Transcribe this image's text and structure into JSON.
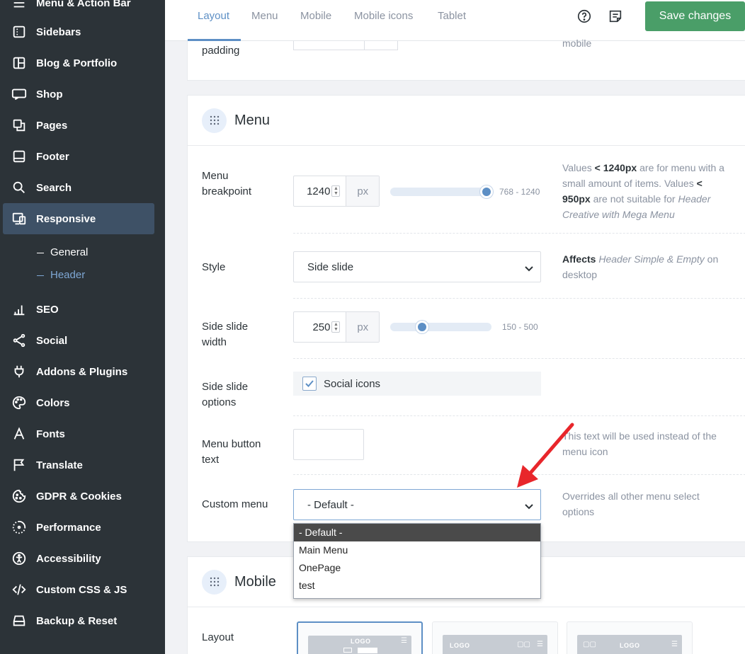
{
  "sidebar": {
    "items": [
      {
        "label": "Menu & Action Bar",
        "icon": "menu-icon"
      },
      {
        "label": "Sidebars",
        "icon": "sidebar-icon"
      },
      {
        "label": "Blog & Portfolio",
        "icon": "grid-icon"
      },
      {
        "label": "Shop",
        "icon": "woo-icon"
      },
      {
        "label": "Pages",
        "icon": "pages-icon"
      },
      {
        "label": "Footer",
        "icon": "footer-icon"
      },
      {
        "label": "Search",
        "icon": "search-icon"
      },
      {
        "label": "Responsive",
        "icon": "devices-icon",
        "active": true
      },
      {
        "label": "SEO",
        "icon": "bar-chart-icon"
      },
      {
        "label": "Social",
        "icon": "share-icon"
      },
      {
        "label": "Addons & Plugins",
        "icon": "plug-icon"
      },
      {
        "label": "Colors",
        "icon": "palette-icon"
      },
      {
        "label": "Fonts",
        "icon": "font-icon"
      },
      {
        "label": "Translate",
        "icon": "flag-icon"
      },
      {
        "label": "GDPR & Cookies",
        "icon": "cookie-icon"
      },
      {
        "label": "Performance",
        "icon": "gauge-icon"
      },
      {
        "label": "Accessibility",
        "icon": "accessibility-icon"
      },
      {
        "label": "Custom CSS & JS",
        "icon": "code-icon"
      },
      {
        "label": "Backup & Reset",
        "icon": "backup-icon"
      }
    ],
    "subitems": [
      {
        "label": "General",
        "active": false
      },
      {
        "label": "Header",
        "active": true
      }
    ]
  },
  "tabs": [
    "Layout",
    "Menu",
    "Mobile",
    "Mobile icons",
    "Tablet"
  ],
  "toolbar": {
    "save_label": "Save changes",
    "help_icon": "help-icon",
    "notes_icon": "notes-icon"
  },
  "top_partial": {
    "label": "padding",
    "help": "mobile"
  },
  "menu_section": {
    "title": "Menu",
    "breakpoint": {
      "label": "Menu breakpoint",
      "value": "1240",
      "unit": "px",
      "range": "768 - 1240",
      "min": 768,
      "max": 1240,
      "help_parts": [
        "Values ",
        "< 1240px",
        " are for menu with a small amount of items. Values ",
        "< 950px",
        " are not suitable for ",
        "Header Creative with Mega Menu"
      ]
    },
    "style": {
      "label": "Style",
      "value": "Side slide",
      "help_parts": [
        "Affects",
        " Header Simple & Empty",
        " on desktop"
      ]
    },
    "side_width": {
      "label": "Side slide width",
      "value": "250",
      "unit": "px",
      "range": "150 - 500",
      "min": 150,
      "max": 500
    },
    "side_options": {
      "label": "Side slide options",
      "checkbox_label": "Social icons",
      "checked": true
    },
    "button_text": {
      "label": "Menu button text",
      "value": "",
      "help": "This text will be used instead of the menu icon"
    },
    "custom_menu": {
      "label": "Custom menu",
      "value": "- Default -",
      "help": "Overrides all other menu select options",
      "options": [
        "- Default -",
        "Main Menu",
        "OnePage",
        "test"
      ]
    }
  },
  "mobile_section": {
    "title": "Mobile",
    "layout_label": "Layout",
    "tile_logo": "LOGO"
  },
  "colors": {
    "accent": "#5d8fc5",
    "save": "#4a9e68",
    "sidebar": "#2c3338",
    "arrow": "#e8262b"
  }
}
